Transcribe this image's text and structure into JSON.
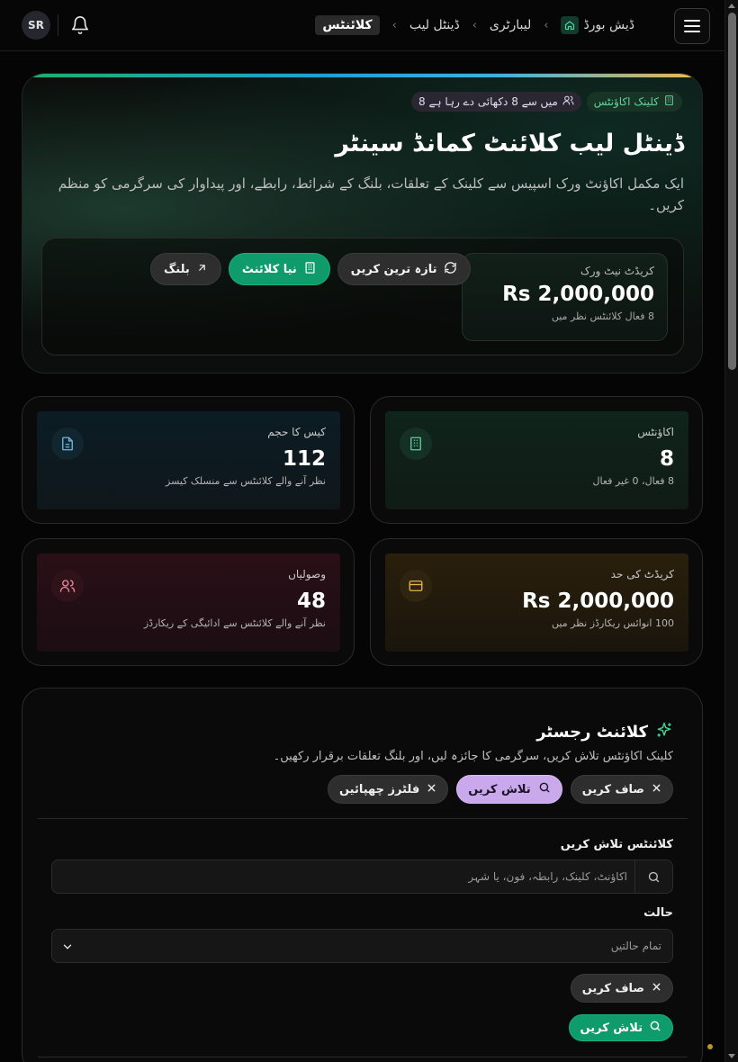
{
  "header": {
    "avatar_initials": "SR",
    "breadcrumbs": [
      {
        "label": "ڈیش بورڈ",
        "icon": "home-icon"
      },
      {
        "label": "لیبارٹری"
      },
      {
        "label": "ڈینٹل لیب"
      },
      {
        "label": "کلائنٹس",
        "active": true
      }
    ]
  },
  "hero": {
    "badge_section": "کلینک اکاؤنٹس",
    "badge_count": "8 میں سے 8 دکھائی دے رہا ہے",
    "title": "ڈینٹل لیب کلائنٹ کمانڈ سینٹر",
    "description": "ایک مکمل اکاؤنٹ ورک اسپیس سے کلینک کے تعلقات، بلنگ کے شرائط، رابطے، اور پیداوار کی سرگرمی کو منظم کریں۔",
    "credit": {
      "label": "کریڈٹ نیٹ ورک",
      "value": "Rs 2,000,000",
      "sub": "8 فعال کلائنٹس نظر میں"
    },
    "actions": {
      "refresh": "تازہ ترین کریں",
      "new_client": "نیا کلائنٹ",
      "billing": "بلنگ"
    }
  },
  "stats": {
    "accounts": {
      "label": "اکاؤنٹس",
      "value": "8",
      "sub": "8 فعال، 0 غیر فعال"
    },
    "case_volume": {
      "label": "کیس کا حجم",
      "value": "112",
      "sub": "نظر آنے والے کلائنٹس سے منسلک کیسز"
    },
    "credit_limit": {
      "label": "کریڈٹ کی حد",
      "value": "Rs 2,000,000",
      "sub": "100 انوائس ریکارڈز نظر میں"
    },
    "collections": {
      "label": "وصولیاں",
      "value": "48",
      "sub": "نظر آنے والے کلائنٹس سے ادائیگی کے ریکارڈز"
    }
  },
  "register": {
    "title": "کلائنٹ رجسٹر",
    "description": "کلینک اکاؤنٹس تلاش کریں، سرگرمی کا جائزہ لیں، اور بلنگ تعلقات برقرار رکھیں۔",
    "chips": {
      "clear": "صاف کریں",
      "search": "تلاش کریں",
      "hide_filters": "فلٹرز چھپائیں"
    },
    "search_label": "کلائنٹس تلاش کریں",
    "search_placeholder": "اکاؤنٹ، کلینک، رابطہ، فون، یا شہر",
    "status_label": "حالت",
    "status_value": "تمام حالتیں",
    "clear_button": "صاف کریں",
    "search_button": "تلاش کریں"
  },
  "colors": {
    "accent_green": "#0f9b6c",
    "lilac": "#c9a8ec"
  }
}
